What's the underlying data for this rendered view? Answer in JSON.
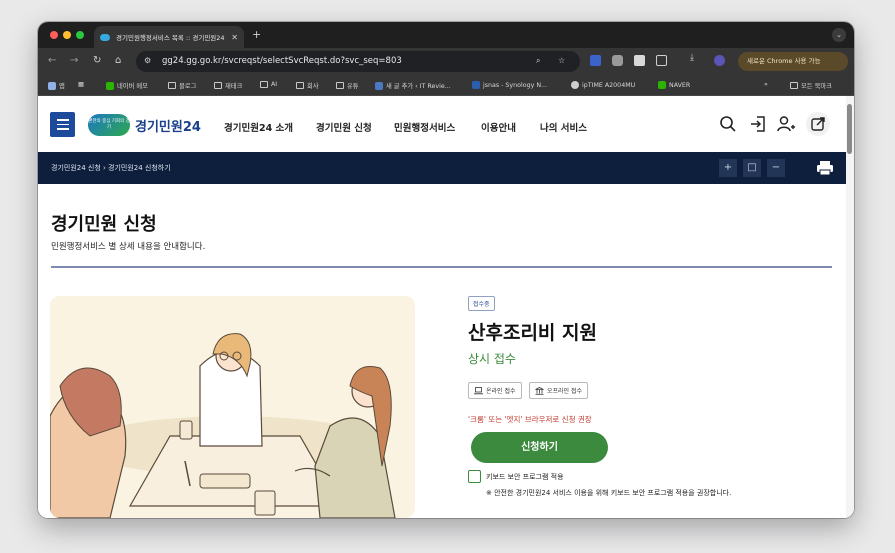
{
  "browser": {
    "tab_title": "경기민원행정서비스 목록 :: 경기민원24",
    "tab_close": "✕",
    "new_tab": "+",
    "url": "gg24.gg.go.kr/svcreqst/selectSvcReqst.do?svc_seq=803",
    "update_button": "새로운 Chrome 사용 가능",
    "bookmarks": [
      "앱",
      "네이버 메모",
      "블로그",
      "재테크",
      "AI",
      "회사",
      "유튜",
      "새 글 추가 ‹ IT Revie...",
      "jsnas - Synology N...",
      "ipTIME A2004MU",
      "NAVER"
    ],
    "bookmarks_more": "»",
    "all_bookmarks": "모든 북마크"
  },
  "header": {
    "logo_badge": "편한의 중심 기회의 경기",
    "logo_text": "경기민원24",
    "menu": [
      "경기민원24 소개",
      "경기민원 신청",
      "민원행정서비스",
      "이용안내",
      "나의 서비스"
    ]
  },
  "breadcrumb": {
    "text": "경기민원24 신청 › 경기민원24 신청하기",
    "zoom_in": "+",
    "reset": "□",
    "zoom_out": "−"
  },
  "main": {
    "title": "경기민원 신청",
    "subtitle": "민원행정서비스 별 상세 내용을 안내합니다.",
    "status_tag": "접수중",
    "service_title": "산후조리비 지원",
    "service_status": "상시 접수",
    "modes": [
      "온라인 접수",
      "오프라인 접수"
    ],
    "warning": "'크롬' 또는 '엣지' 브라우저로 신청 권장",
    "apply_button": "신청하기",
    "keyboard_security": "키보드 보안 프로그램 적용",
    "keyboard_note": "※ 안전한 경기민원24 서비스 이용을 위해 키보드 보안 프로그램 적용을 권장합니다."
  },
  "colors": {
    "brand_blue": "#1d4a9a",
    "dark_navy": "#0d1f3c",
    "green": "#3c8a3e",
    "warning_red": "#c0392b"
  }
}
